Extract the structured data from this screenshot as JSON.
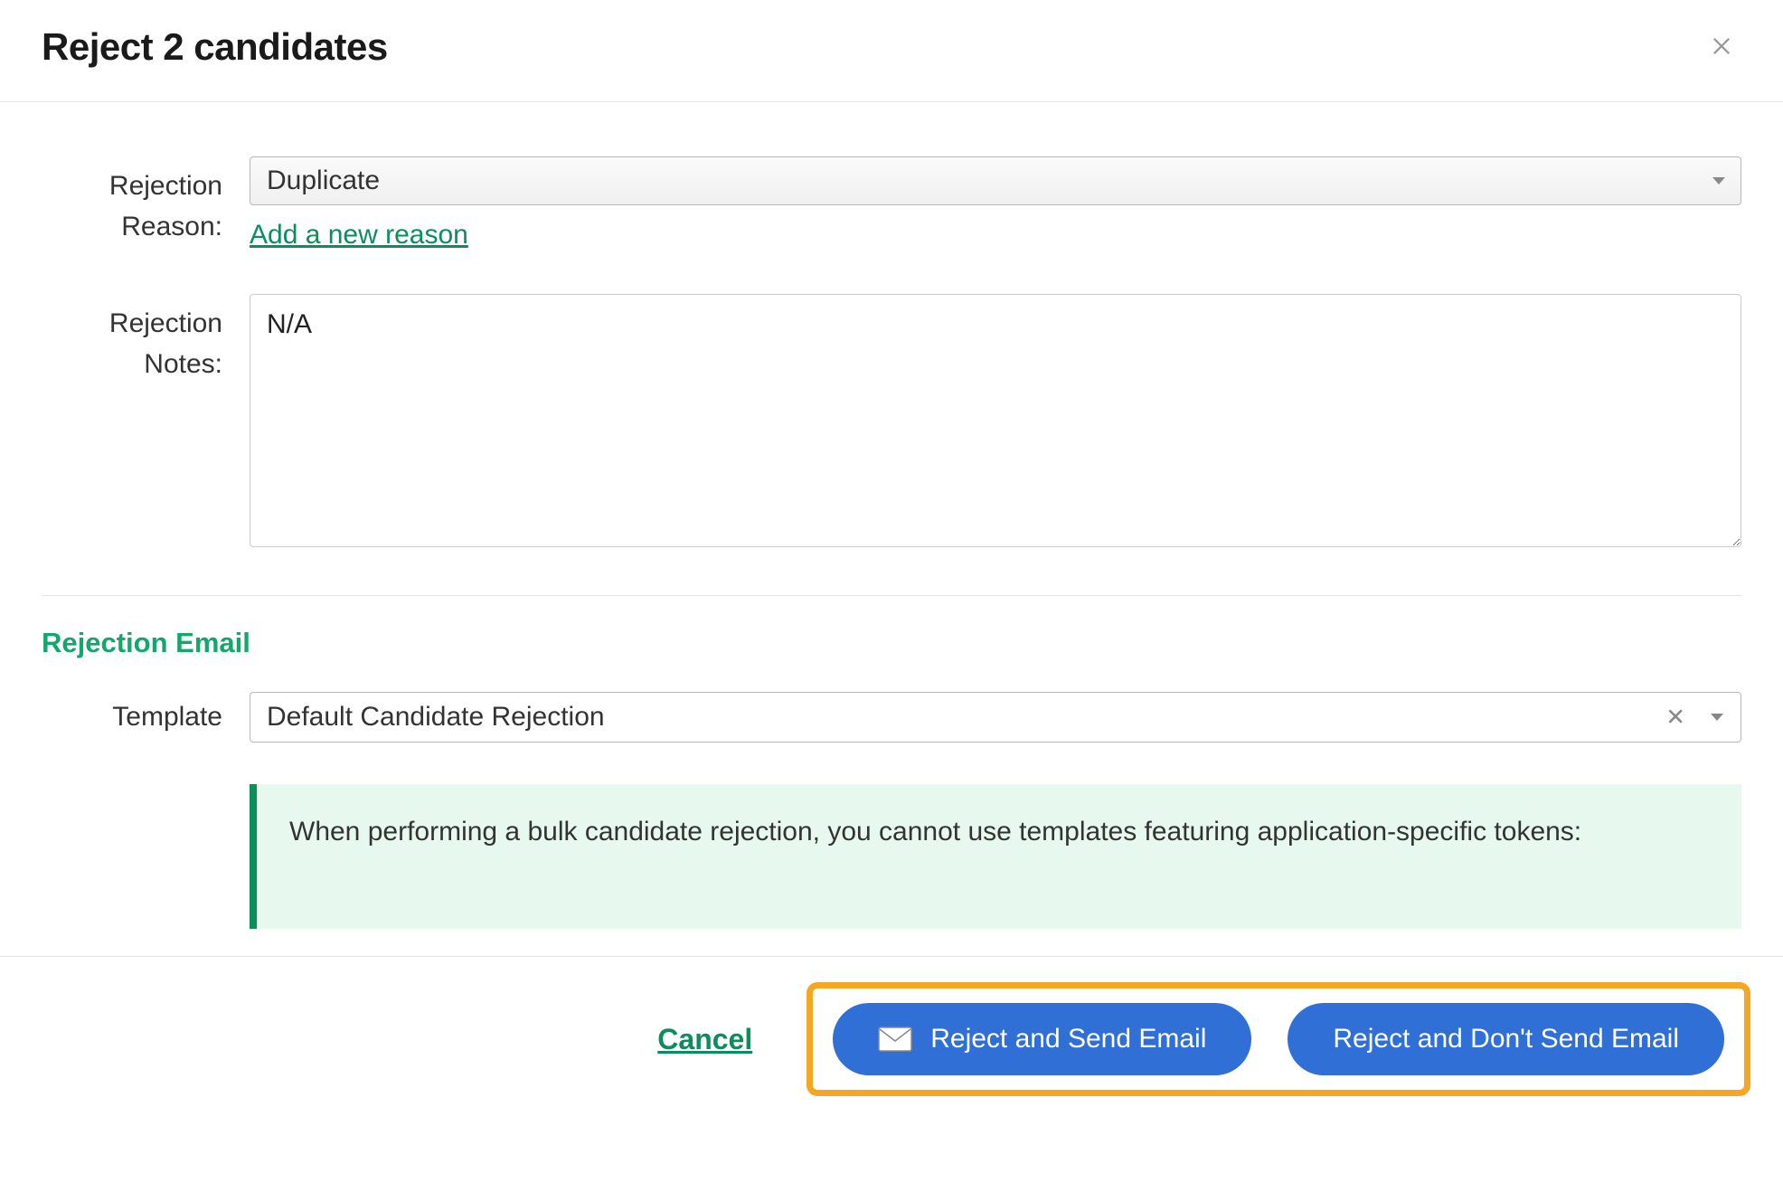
{
  "modal": {
    "title": "Reject 2 candidates"
  },
  "form": {
    "reason_label": "Rejection Reason:",
    "reason_value": "Duplicate",
    "add_reason_label": "Add a new reason",
    "notes_label": "Rejection Notes:",
    "notes_value": "N/A"
  },
  "email_section": {
    "heading": "Rejection Email",
    "template_label": "Template",
    "template_value": "Default Candidate Rejection",
    "info_text": "When performing a bulk candidate rejection, you cannot use templates featuring application-specific tokens:"
  },
  "footer": {
    "cancel_label": "Cancel",
    "reject_send_label": "Reject and Send Email",
    "reject_no_send_label": "Reject and Don't Send Email"
  },
  "colors": {
    "accent_green": "#0a8f5b",
    "accent_blue": "#2f6fd6",
    "highlight_orange": "#f5a623",
    "info_bg": "#e7f8ef"
  }
}
